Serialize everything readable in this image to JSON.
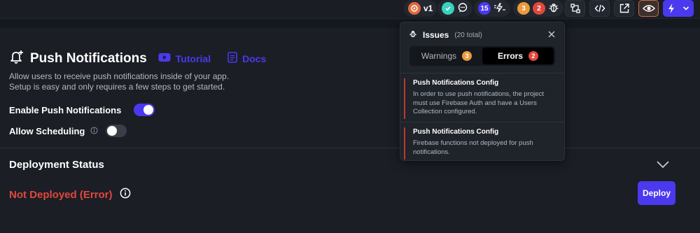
{
  "toolbar": {
    "version_label": "v1",
    "comments_count": "15",
    "warnings_count": "3",
    "errors_count": "2",
    "colors": {
      "accent": "#4b39ef",
      "warning": "#ec9a3c",
      "error": "#e0483d",
      "success": "#39d2c0"
    }
  },
  "page": {
    "title": "Push Notifications",
    "tutorial_link": "Tutorial",
    "docs_link": "Docs",
    "description_line1": "Allow users to receive push notifications inside of your app.",
    "description_line2": "Setup is easy and only requires a few steps to get started.",
    "enable_label": "Enable Push Notifications",
    "enable_on": true,
    "scheduling_label": "Allow Scheduling",
    "scheduling_on": false,
    "deployment_title": "Deployment Status",
    "deployment_status": "Not Deployed (Error)",
    "deploy_button": "Deploy"
  },
  "issues": {
    "title": "Issues",
    "total": "(20 total)",
    "tabs": [
      {
        "label": "Warnings",
        "count": "3"
      },
      {
        "label": "Errors",
        "count": "2"
      }
    ],
    "items": [
      {
        "title": "Push Notifications Config",
        "body": "In order to use push notifications, the project must use Firebase Auth and have a Users Collection configured."
      },
      {
        "title": "Push Notifications Config",
        "body": "Firebase functions not deployed for push notifications."
      }
    ]
  }
}
